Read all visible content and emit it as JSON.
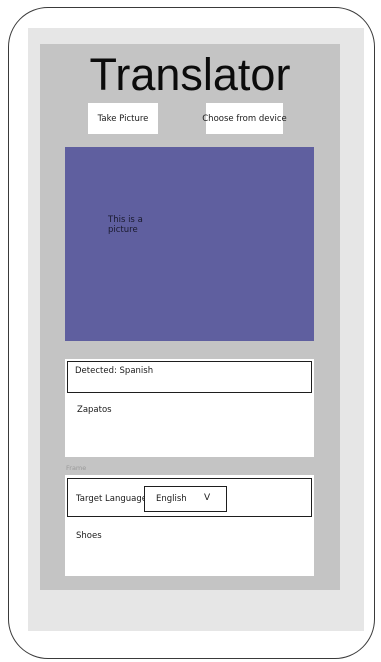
{
  "app": {
    "title": "Translator"
  },
  "actions": {
    "take_picture_label": "Take Picture",
    "choose_from_device_label": "Choose from device"
  },
  "picture": {
    "caption": "This is  a picture",
    "background_color": "#5f5f9f"
  },
  "detected": {
    "label": "Detected: Spanish",
    "text": "Zapatos"
  },
  "frame": {
    "label": "Frame"
  },
  "translation": {
    "target_language_label": "Target Language:",
    "selected_language": "English",
    "dropdown_glyph": "V",
    "text": "Shoes"
  }
}
